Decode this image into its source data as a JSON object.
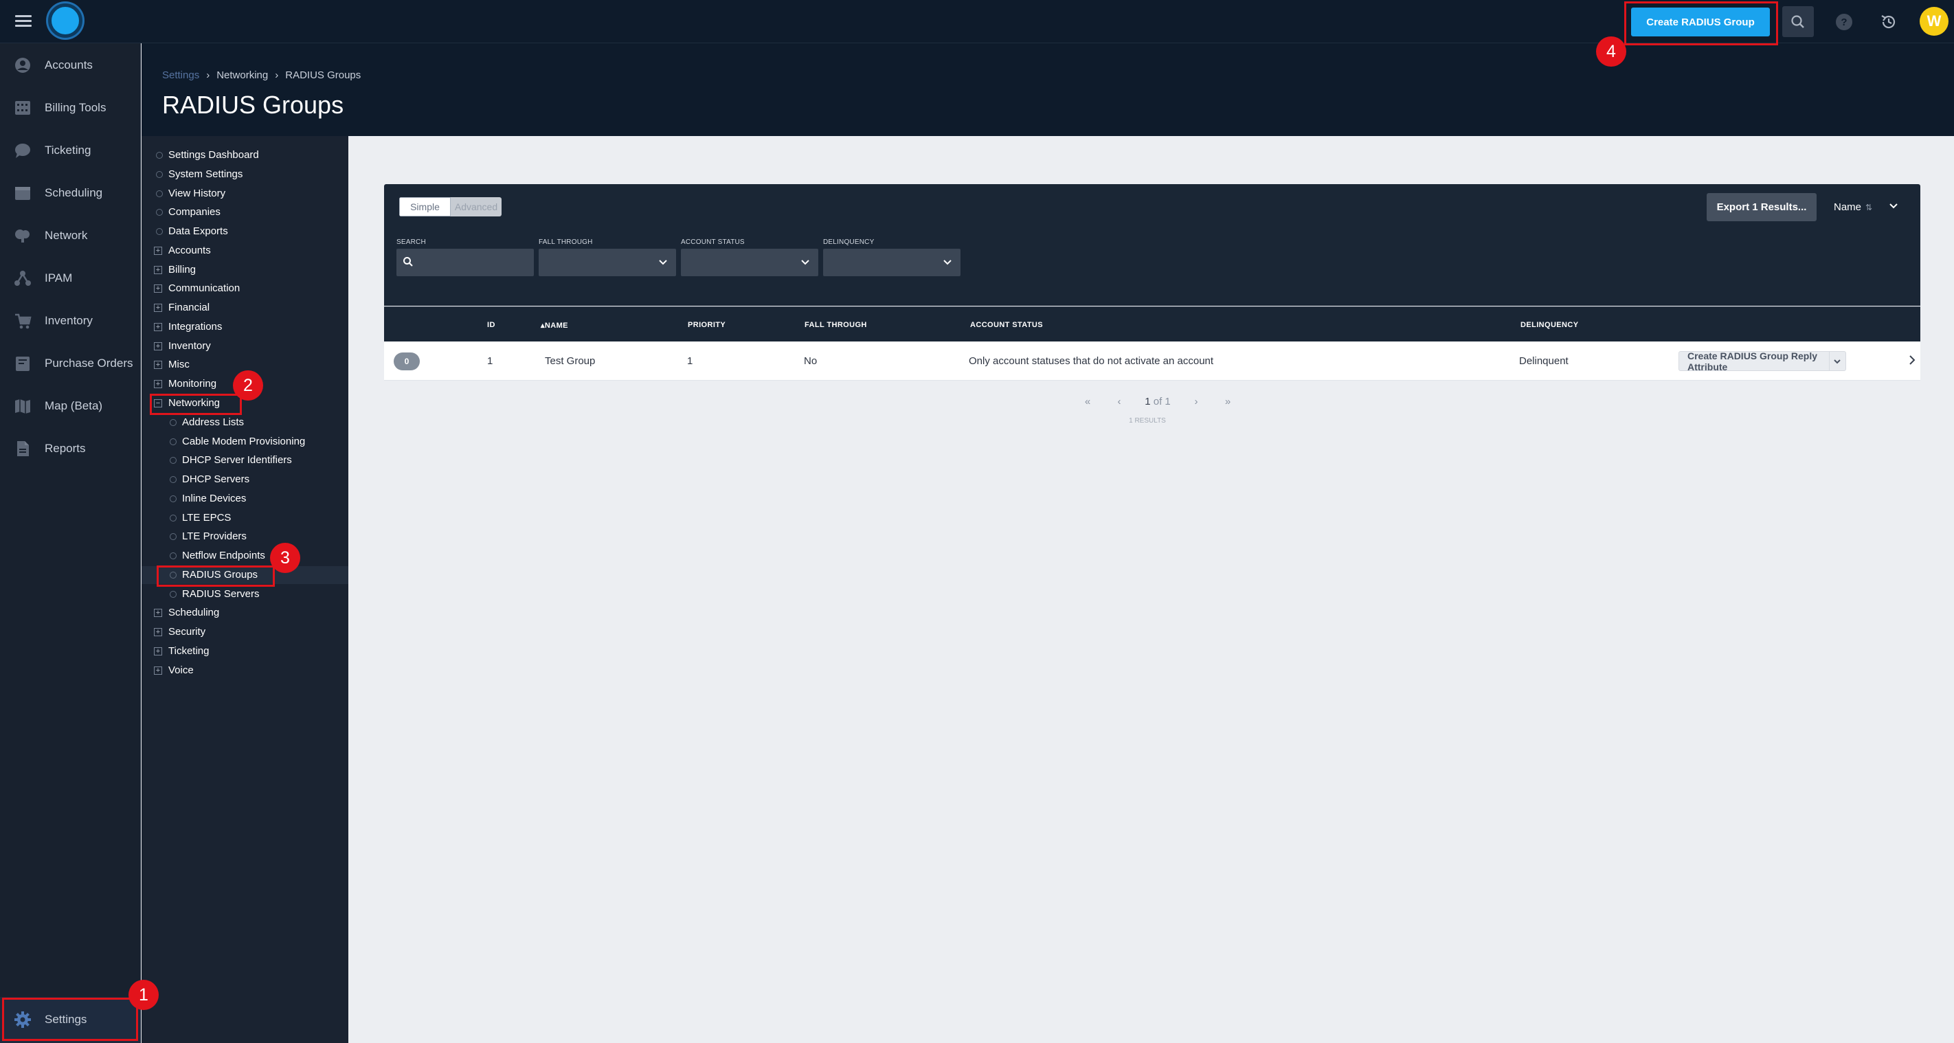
{
  "header": {
    "create_button": "Create RADIUS Group",
    "help_label": "?",
    "avatar_initial": "W",
    "accent_color": "#1aa3ee",
    "icons": [
      "menu-icon",
      "search-icon",
      "help-icon",
      "history-icon"
    ]
  },
  "nav": {
    "items": [
      {
        "label": "Accounts",
        "icon": "user-circle-icon"
      },
      {
        "label": "Billing Tools",
        "icon": "calculator-icon"
      },
      {
        "label": "Ticketing",
        "icon": "chat-bubble-icon"
      },
      {
        "label": "Scheduling",
        "icon": "calendar-icon"
      },
      {
        "label": "Network",
        "icon": "network-icon"
      },
      {
        "label": "IPAM",
        "icon": "ipam-nodes-icon"
      },
      {
        "label": "Inventory",
        "icon": "cart-icon"
      },
      {
        "label": "Purchase Orders",
        "icon": "purchase-order-icon"
      },
      {
        "label": "Map (Beta)",
        "icon": "map-icon"
      },
      {
        "label": "Reports",
        "icon": "report-icon"
      }
    ],
    "settings": "Settings"
  },
  "page": {
    "breadcrumb": [
      "Settings",
      "Networking",
      "RADIUS Groups"
    ],
    "breadcrumb_sep": "›",
    "title": "RADIUS Groups"
  },
  "settings_tree": {
    "top": [
      "Settings Dashboard",
      "System Settings",
      "View History",
      "Companies",
      "Data Exports"
    ],
    "groups_before": [
      "Accounts",
      "Billing",
      "Communication",
      "Financial",
      "Integrations",
      "Inventory",
      "Misc",
      "Monitoring"
    ],
    "expanded": "Networking",
    "expanded_marker": "−",
    "collapsed_marker": "+",
    "networking_children": [
      "Address Lists",
      "Cable Modem Provisioning",
      "DHCP Server Identifiers",
      "DHCP Servers",
      "Inline Devices",
      "LTE EPCS",
      "LTE Providers",
      "Netflow Endpoints",
      "RADIUS Groups",
      "RADIUS Servers"
    ],
    "active": "RADIUS Groups",
    "groups_after": [
      "Scheduling",
      "Security",
      "Ticketing",
      "Voice"
    ]
  },
  "filters": {
    "mode_simple": "Simple",
    "mode_advanced": "Advanced",
    "export_button": "Export 1 Results...",
    "sort_label": "Name",
    "sort_icon": "⇅",
    "search_label": "SEARCH",
    "fall_through_label": "FALL THROUGH",
    "account_status_label": "ACCOUNT STATUS",
    "delinquency_label": "DELINQUENCY"
  },
  "table": {
    "columns": [
      "ID",
      "NAME",
      "PRIORITY",
      "FALL THROUGH",
      "ACCOUNT STATUS",
      "DELINQUENCY"
    ],
    "name_sort_marker": "▴",
    "rows": [
      {
        "badge": "0",
        "id": "1",
        "name": "Test Group",
        "priority": "1",
        "fall_through": "No",
        "account_status": "Only account statuses that do not activate an account",
        "delinquency": "Delinquent",
        "action": "Create RADIUS Group Reply Attribute"
      }
    ]
  },
  "pagination": {
    "first": "«",
    "prev": "‹",
    "current": "1",
    "of_text": "of 1",
    "next": "›",
    "last": "»",
    "results": "1 RESULTS"
  },
  "annotations": {
    "steps": [
      "1",
      "2",
      "3",
      "4"
    ],
    "color": "#e0141b"
  }
}
